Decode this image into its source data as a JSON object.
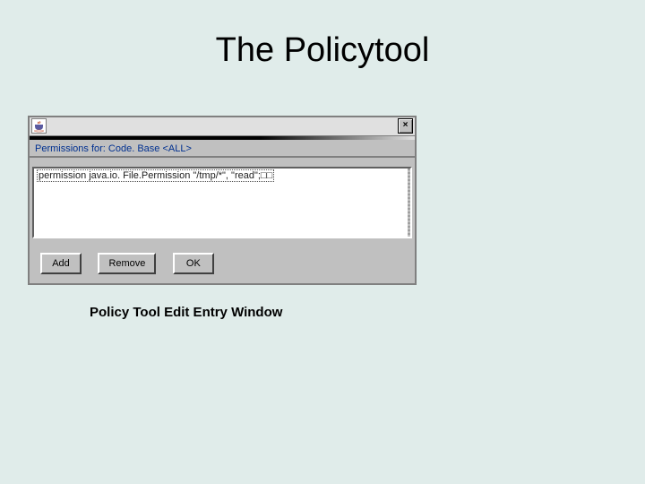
{
  "slide": {
    "title": "The Policytool",
    "caption": "Policy Tool Edit Entry Window"
  },
  "window": {
    "close_symbol": "×",
    "header_label": "Permissions for:  Code. Base <ALL>",
    "permission_entry": "permission java.io. File.Permission \"/tmp/*\", \"read\";□□",
    "buttons": {
      "add": "Add",
      "remove": "Remove",
      "ok": "OK"
    }
  }
}
